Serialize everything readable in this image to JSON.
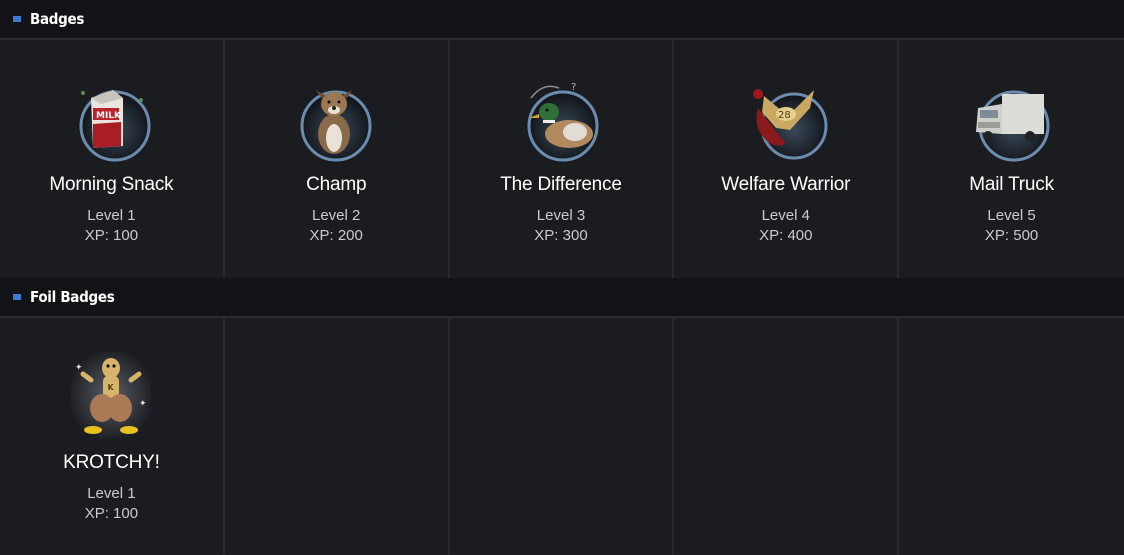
{
  "sections": [
    {
      "title": "Badges",
      "badges": [
        {
          "name": "Morning Snack",
          "level": "Level 1",
          "xp": "XP: 100",
          "icon": "milk-carton-icon"
        },
        {
          "name": "Champ",
          "level": "Level 2",
          "xp": "XP: 200",
          "icon": "dog-icon"
        },
        {
          "name": "The Difference",
          "level": "Level 3",
          "xp": "XP: 300",
          "icon": "duck-icon"
        },
        {
          "name": "Welfare Warrior",
          "level": "Level 4",
          "xp": "XP: 400",
          "icon": "badge-28-icon"
        },
        {
          "name": "Mail Truck",
          "level": "Level 5",
          "xp": "XP: 500",
          "icon": "mail-truck-icon"
        }
      ]
    },
    {
      "title": "Foil Badges",
      "badges": [
        {
          "name": "KROTCHY!",
          "level": "Level 1",
          "xp": "XP: 100",
          "icon": "krotchy-icon"
        }
      ]
    }
  ],
  "colors": {
    "background": "#1b1c20",
    "header_background": "#121316",
    "marker": "#3a7bd5",
    "divider": "#2a2b30",
    "subtext": "#c9cbd0"
  }
}
